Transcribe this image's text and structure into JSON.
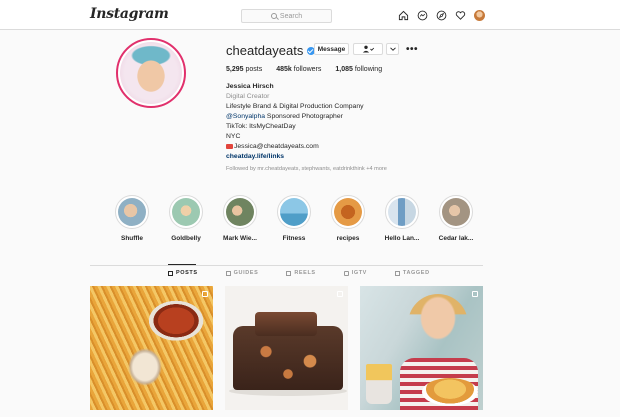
{
  "nav": {
    "logo": "Instagram",
    "search_placeholder": "Search",
    "icons": [
      "home-icon",
      "messenger-icon",
      "explore-icon",
      "heart-icon",
      "profile-avatar"
    ]
  },
  "profile": {
    "username": "cheatdayeats",
    "verified": true,
    "message_label": "Message",
    "stats": {
      "posts": "5,295",
      "posts_label": "posts",
      "followers": "485k",
      "followers_label": "followers",
      "following": "1,085",
      "following_label": "following"
    },
    "bio": {
      "name": "Jessica Hirsch",
      "category": "Digital Creator",
      "line1": "Lifestyle Brand & Digital Production Company",
      "mention": "@Sonyalpha",
      "mention_rest": " Sponsored Photographer",
      "line3": "TikTok: ItsMyCheatDay",
      "line4": "NYC",
      "email": "Jessica@cheatdayeats.com",
      "url": "cheatday.life/links"
    },
    "followed_by": "Followed by mr.cheatdayeats, stephwants, eatdrinkthink +4 more"
  },
  "highlights": [
    {
      "label": "Shuffle",
      "color": "#c9a98a"
    },
    {
      "label": "Goldbelly",
      "color": "#8fb9a8"
    },
    {
      "label": "Mark Wie...",
      "color": "#7d8f6a"
    },
    {
      "label": "Fitness",
      "color": "#6fb0d1"
    },
    {
      "label": "recipes",
      "color": "#c9762e"
    },
    {
      "label": "Hello Lan...",
      "color": "#7ea7c8"
    },
    {
      "label": "Cedar lak...",
      "color": "#b2a08e"
    }
  ],
  "tabs": [
    {
      "label": "POSTS",
      "active": true
    },
    {
      "label": "GUIDES",
      "active": false
    },
    {
      "label": "REELS",
      "active": false
    },
    {
      "label": "IGTV",
      "active": false
    },
    {
      "label": "TAGGED",
      "active": false
    }
  ],
  "colors": {
    "accent": "#3897f0",
    "link": "#003569",
    "muted": "#8e8e8e",
    "border": "#dbdbdb"
  }
}
